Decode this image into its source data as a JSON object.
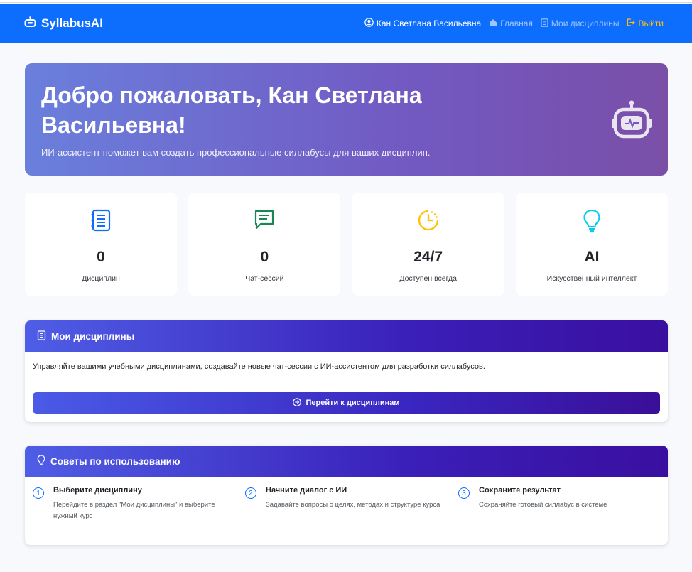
{
  "brand": {
    "name": "SyllabusAI",
    "icon": "robot-icon"
  },
  "nav": {
    "user": "Кан Светлана Васильевна",
    "home": "Главная",
    "disciplines": "Мои дисциплины",
    "logout": "Выйти"
  },
  "hero": {
    "title": "Добро пожаловать, Кан Светлана Васильевна!",
    "subtitle": "ИИ-ассистент поможет вам создать профессиональные силлабусы для ваших дисциплин.",
    "icon": "robot-icon"
  },
  "stats": [
    {
      "value": "0",
      "label": "Дисциплин",
      "icon": "journal-icon",
      "color": "#0d6efd"
    },
    {
      "value": "0",
      "label": "Чат-сессий",
      "icon": "chat-icon",
      "color": "#198754"
    },
    {
      "value": "24/7",
      "label": "Доступен всегда",
      "icon": "clock-icon",
      "color": "#ffc107"
    },
    {
      "value": "AI",
      "label": "Искусственный интеллект",
      "icon": "lightbulb-icon",
      "color": "#0dcaf0"
    }
  ],
  "disciplines_card": {
    "title": "Мои дисциплины",
    "description": "Управляйте вашими учебными дисциплинами, создавайте новые чат-сессии с ИИ-ассистентом для разработки силлабусов.",
    "button": "Перейти к дисциплинам"
  },
  "tips_card": {
    "title": "Советы по использованию",
    "tips": [
      {
        "num": "1",
        "title": "Выберите дисциплину",
        "text": "Перейдите в раздел \"Мои дисциплины\" и выберите нужный курс"
      },
      {
        "num": "2",
        "title": "Начните диалог с ИИ",
        "text": "Задавайте вопросы о целях, методах и структуре курса"
      },
      {
        "num": "3",
        "title": "Сохраните результат",
        "text": "Сохраняйте готовый силлабус в системе"
      }
    ]
  },
  "colors": {
    "primary": "#0d6efd",
    "warning": "#ffc107",
    "hero_start": "#6a7fdc",
    "hero_end": "#7a4fa8"
  }
}
